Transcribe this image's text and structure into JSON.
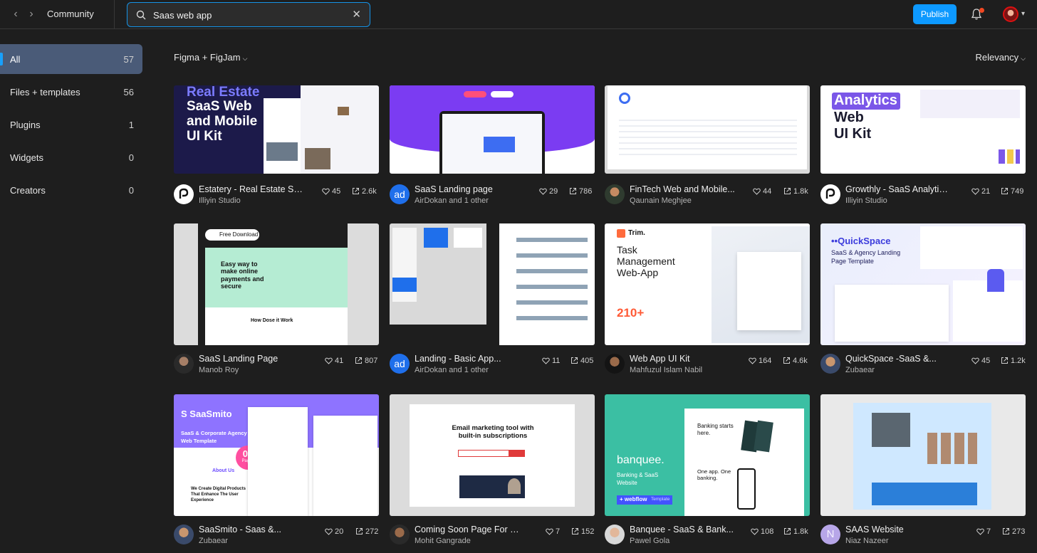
{
  "topbar": {
    "breadcrumb": "Community",
    "search_value": "Saas web app",
    "publish_label": "Publish"
  },
  "sidebar": {
    "items": [
      {
        "label": "All",
        "count": "57",
        "active": true
      },
      {
        "label": "Files + templates",
        "count": "56"
      },
      {
        "label": "Plugins",
        "count": "1"
      },
      {
        "label": "Widgets",
        "count": "0"
      },
      {
        "label": "Creators",
        "count": "0"
      }
    ]
  },
  "filters": {
    "left": "Figma + FigJam",
    "right": "Relevancy"
  },
  "thumb_text": {
    "estatery_a": "Real Estate",
    "estatery_b": "SaaS Web",
    "estatery_c": "and Mobile",
    "estatery_d": "UI Kit",
    "growthly_a": "Analytics",
    "growthly_b": "Web",
    "growthly_c": "UI Kit",
    "fd_btn": "Free Download",
    "fd_head": "Easy way to make online payments and secure",
    "fd_sub": "How Dose it Work",
    "trim_logo": "Trim.",
    "trim_a": "Task",
    "trim_b": "Management",
    "trim_c": "Web-App",
    "trim_num": "210+",
    "qs_logo": "QuickSpace",
    "qs_sub": "SaaS & Agency Landing Page Template",
    "sm_logo": "SaaSmito",
    "sm_sub": "SaaS & Corporate Agency Web Template",
    "sm_badge": "09",
    "sm_badge_sub": "Pages",
    "sm_about": "About Us",
    "sm_we": "We Create Digital Products That Enhance The User Experience",
    "em_head": "Email marketing tool with built-in subscriptions",
    "bq_logo": "banquee.",
    "bq_sub": "Banking & SaaS Website",
    "bq_wf": "webflow",
    "bq_tpl": "Template",
    "bq_head": "Banking starts here.",
    "bq_app": "One app. One banking."
  },
  "cards": [
    {
      "title": "Estatery - Real Estate Sa...",
      "author": "Illiyin Studio",
      "likes": "45",
      "uses": "2.6k"
    },
    {
      "title": "SaaS Landing page",
      "author": "AirDokan and 1 other",
      "likes": "29",
      "uses": "786",
      "avatar_text": "ad"
    },
    {
      "title": "FinTech Web and Mobile...",
      "author": "Qaunain Meghjee",
      "likes": "44",
      "uses": "1.8k"
    },
    {
      "title": "Growthly - SaaS Analytics ...",
      "author": "Illiyin Studio",
      "likes": "21",
      "uses": "749"
    },
    {
      "title": "SaaS Landing Page",
      "author": "Manob Roy",
      "likes": "41",
      "uses": "807"
    },
    {
      "title": "Landing - Basic App...",
      "author": "AirDokan and 1 other",
      "likes": "11",
      "uses": "405",
      "avatar_text": "ad"
    },
    {
      "title": "Web App UI Kit",
      "author": "Mahfuzul Islam Nabil",
      "likes": "164",
      "uses": "4.6k"
    },
    {
      "title": "QuickSpace -SaaS &...",
      "author": "Zubaear",
      "likes": "45",
      "uses": "1.2k"
    },
    {
      "title": "SaaSmito - Saas &...",
      "author": "Zubaear",
      "likes": "20",
      "uses": "272"
    },
    {
      "title": "Coming Soon Page For Saa...",
      "author": "Mohit Gangrade",
      "likes": "7",
      "uses": "152"
    },
    {
      "title": "Banquee - SaaS & Bank...",
      "author": "Pawel Gola",
      "likes": "108",
      "uses": "1.8k"
    },
    {
      "title": "SAAS Website",
      "author": "Niaz Nazeer",
      "likes": "7",
      "uses": "273",
      "avatar_text": "N"
    }
  ],
  "colors": {
    "accent": "#0d99ff",
    "sidebar_active": "#4a5b78",
    "background": "#1e1e1e"
  }
}
